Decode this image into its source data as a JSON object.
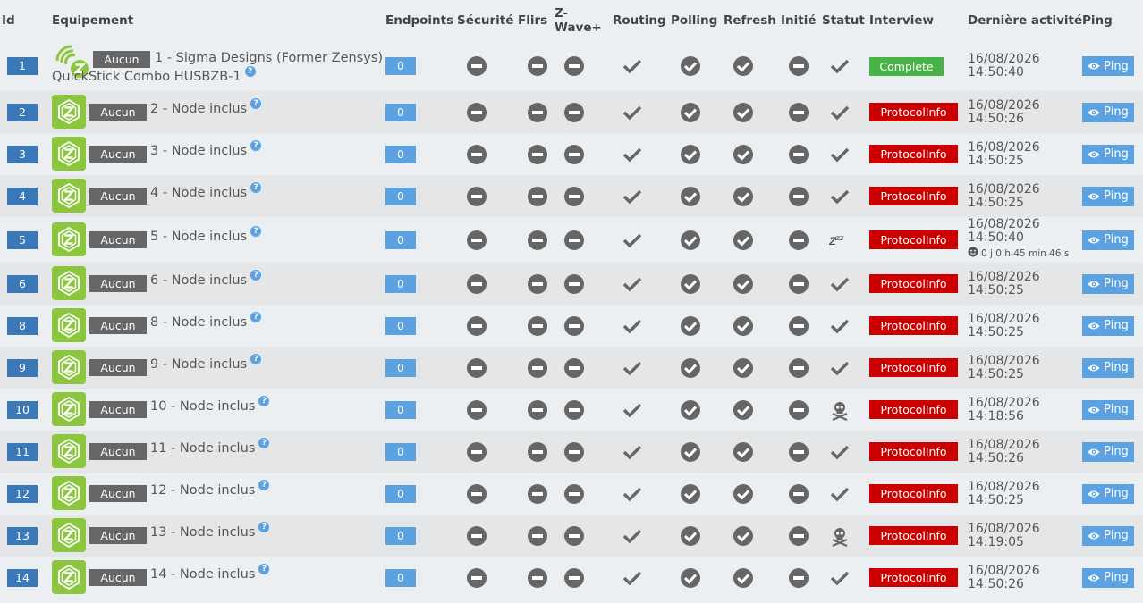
{
  "headers": {
    "id": "Id",
    "equipement": "Equipement",
    "endpoints": "Endpoints",
    "securite": "Sécurité",
    "flirs": "Flirs",
    "zwave": "Z-Wave+",
    "routing": "Routing",
    "polling": "Polling",
    "refresh": "Refresh",
    "initie": "Initié",
    "statut": "Statut",
    "interview": "Interview",
    "derniere": "Dernière activité",
    "ping": "Ping"
  },
  "common": {
    "aucun": "Aucun",
    "ping": "Ping",
    "help": "?"
  },
  "rows": [
    {
      "id": "1",
      "name": "1 - Sigma Designs (Former Zensys)",
      "name2": "QuickStick Combo HUSBZB-1",
      "endpoints": "0",
      "statut": "check",
      "interview": "Complete",
      "date": "16/08/2026",
      "time": "14:50:40",
      "controller": true
    },
    {
      "id": "2",
      "name": "2 - Node inclus",
      "endpoints": "0",
      "statut": "check",
      "interview": "ProtocolInfo",
      "date": "16/08/2026",
      "time": "14:50:26"
    },
    {
      "id": "3",
      "name": "3 - Node inclus",
      "endpoints": "0",
      "statut": "check",
      "interview": "ProtocolInfo",
      "date": "16/08/2026",
      "time": "14:50:25"
    },
    {
      "id": "4",
      "name": "4 - Node inclus",
      "endpoints": "0",
      "statut": "check",
      "interview": "ProtocolInfo",
      "date": "16/08/2026",
      "time": "14:50:25"
    },
    {
      "id": "5",
      "name": "5 - Node inclus",
      "endpoints": "0",
      "statut": "sleep",
      "interview": "ProtocolInfo",
      "date": "16/08/2026",
      "time": "14:50:40",
      "wake": "0 j 0 h 45 min 46 s",
      "statut_text": "zzz"
    },
    {
      "id": "6",
      "name": "6 - Node inclus",
      "endpoints": "0",
      "statut": "check",
      "interview": "ProtocolInfo",
      "date": "16/08/2026",
      "time": "14:50:25"
    },
    {
      "id": "8",
      "name": "8 - Node inclus",
      "endpoints": "0",
      "statut": "check",
      "interview": "ProtocolInfo",
      "date": "16/08/2026",
      "time": "14:50:25"
    },
    {
      "id": "9",
      "name": "9 - Node inclus",
      "endpoints": "0",
      "statut": "check",
      "interview": "ProtocolInfo",
      "date": "16/08/2026",
      "time": "14:50:25"
    },
    {
      "id": "10",
      "name": "10 - Node inclus",
      "endpoints": "0",
      "statut": "dead",
      "interview": "ProtocolInfo",
      "date": "16/08/2026",
      "time": "14:18:56"
    },
    {
      "id": "11",
      "name": "11 - Node inclus",
      "endpoints": "0",
      "statut": "check",
      "interview": "ProtocolInfo",
      "date": "16/08/2026",
      "time": "14:50:26"
    },
    {
      "id": "12",
      "name": "12 - Node inclus",
      "endpoints": "0",
      "statut": "check",
      "interview": "ProtocolInfo",
      "date": "16/08/2026",
      "time": "14:50:25"
    },
    {
      "id": "13",
      "name": "13 - Node inclus",
      "endpoints": "0",
      "statut": "dead",
      "interview": "ProtocolInfo",
      "date": "16/08/2026",
      "time": "14:19:05"
    },
    {
      "id": "14",
      "name": "14 - Node inclus",
      "endpoints": "0",
      "statut": "check",
      "interview": "ProtocolInfo",
      "date": "16/08/2026",
      "time": "14:50:26"
    }
  ],
  "colors": {
    "idBadge": "#3a78b8",
    "endpointBadge": "#5da2e0",
    "complete": "#49b348",
    "protocolInfo": "#cc0000",
    "zwaveGreen": "#8cc63f",
    "aucun": "#666666",
    "iconGrey": "#666666"
  },
  "icons": {
    "securite": "minus-circle-icon",
    "flirs": "minus-circle-icon",
    "zwave": "minus-circle-icon",
    "routing": "check-icon",
    "polling": "check-circle-icon",
    "refresh": "check-circle-icon",
    "initie": "minus-circle-icon",
    "statut_ok": "check-icon",
    "statut_dead": "skull-icon",
    "statut_sleep": "sleep-icon",
    "ping": "eye-icon"
  }
}
